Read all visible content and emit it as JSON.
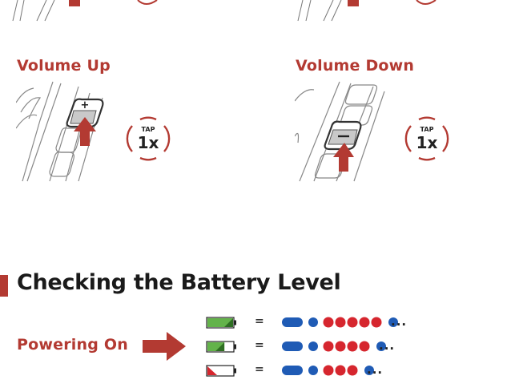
{
  "volume_up": {
    "label": "Volume Up",
    "tap": {
      "word": "TAP",
      "count": "1x"
    },
    "button_symbol": "+"
  },
  "volume_down": {
    "label": "Volume Down",
    "tap": {
      "word": "TAP",
      "count": "1x"
    },
    "button_symbol": "−"
  },
  "battery_section": {
    "heading": "Checking the Battery Level",
    "powering_on_label": "Powering On",
    "rows": [
      {
        "level": "high",
        "equals": "=",
        "red_blinks": 5,
        "ellipsis": "..."
      },
      {
        "level": "medium",
        "equals": "=",
        "red_blinks": 4,
        "ellipsis": "..."
      },
      {
        "level": "low",
        "equals": "=",
        "red_blinks": 3,
        "ellipsis": "..."
      }
    ]
  },
  "colors": {
    "accent_red": "#b33a32",
    "blink_blue": "#1f5bb5",
    "blink_red": "#d6262e",
    "battery_green": "#63b34a",
    "battery_red": "#d6262e"
  }
}
